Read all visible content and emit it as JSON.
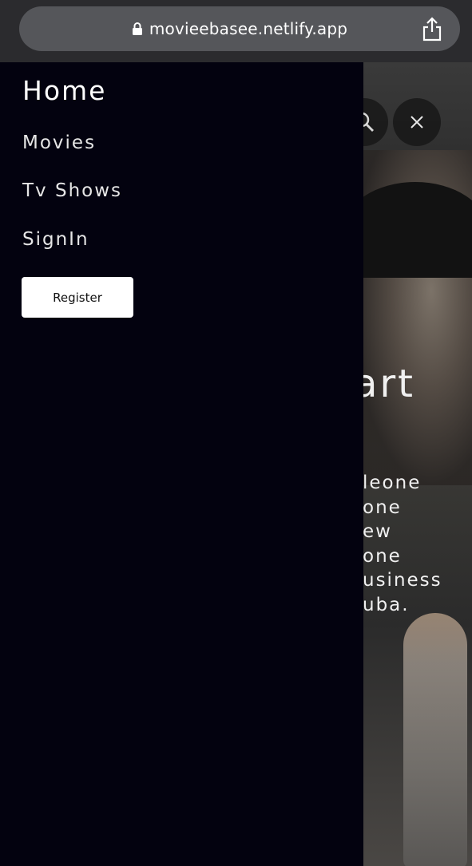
{
  "browser": {
    "url": "movieebasee.netlify.app",
    "lock_icon": "lock-icon",
    "share_icon": "share-icon"
  },
  "drawer": {
    "nav": {
      "home": "Home",
      "movies": "Movies",
      "tv_shows": "Tv Shows",
      "sign_in": "SignIn"
    },
    "register_label": "Register"
  },
  "background_page": {
    "hero_title_fragment": "art",
    "hero_desc_fragments": [
      "leone",
      "one",
      "ew",
      "one",
      "usiness",
      "uba."
    ],
    "search_icon": "search-icon",
    "close_icon": "close-icon"
  },
  "colors": {
    "drawer_bg": "#03020f",
    "url_bar_bg": "#55565a",
    "register_bg": "#ffffff"
  }
}
